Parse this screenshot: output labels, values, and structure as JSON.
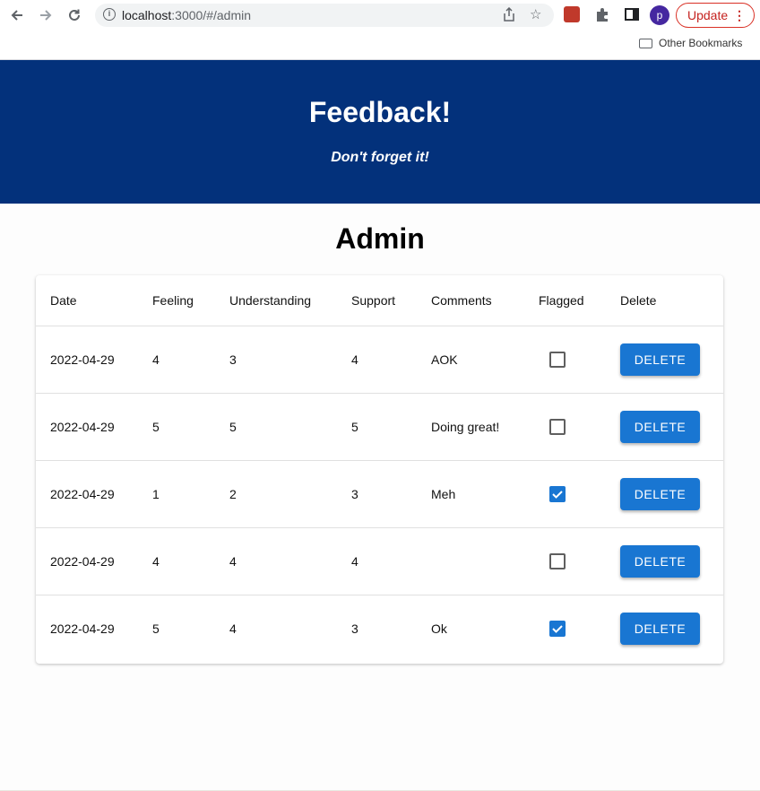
{
  "browser": {
    "url_host": "localhost",
    "url_rest": ":3000/#/admin",
    "profile_initial": "p",
    "update_label": "Update",
    "bookmark_label": "Other Bookmarks"
  },
  "header": {
    "title": "Feedback!",
    "subtitle": "Don't forget it!",
    "bg_color": "#03317b"
  },
  "page_title": "Admin",
  "table": {
    "columns": [
      "Date",
      "Feeling",
      "Understanding",
      "Support",
      "Comments",
      "Flagged",
      "Delete"
    ],
    "rows": [
      {
        "date": "2022-04-29",
        "feeling": "4",
        "understanding": "3",
        "support": "4",
        "comments": "AOK",
        "flagged": false,
        "delete_label": "DELETE"
      },
      {
        "date": "2022-04-29",
        "feeling": "5",
        "understanding": "5",
        "support": "5",
        "comments": "Doing great!",
        "flagged": false,
        "delete_label": "DELETE"
      },
      {
        "date": "2022-04-29",
        "feeling": "1",
        "understanding": "2",
        "support": "3",
        "comments": "Meh",
        "flagged": true,
        "delete_label": "DELETE"
      },
      {
        "date": "2022-04-29",
        "feeling": "4",
        "understanding": "4",
        "support": "4",
        "comments": "",
        "flagged": false,
        "delete_label": "DELETE"
      },
      {
        "date": "2022-04-29",
        "feeling": "5",
        "understanding": "4",
        "support": "3",
        "comments": "Ok",
        "flagged": true,
        "delete_label": "DELETE"
      }
    ],
    "accent_color": "#1976d2"
  }
}
